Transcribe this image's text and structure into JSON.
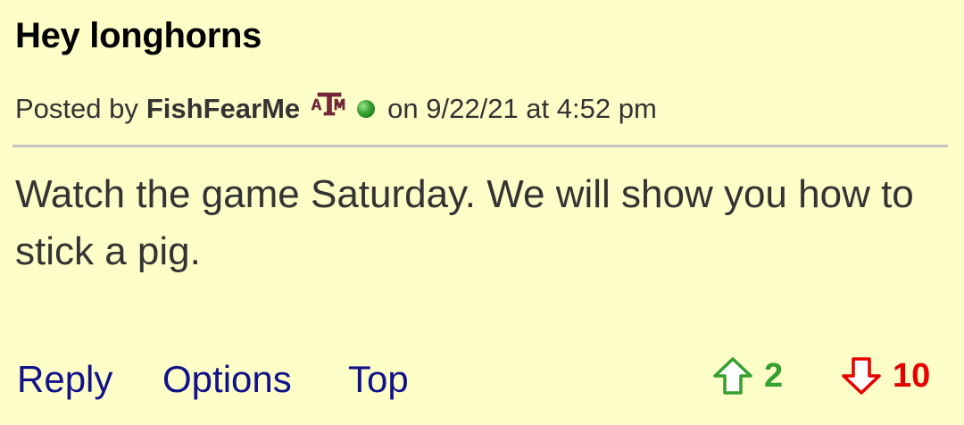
{
  "post": {
    "title": "Hey longhorns",
    "posted_by_prefix": "Posted by",
    "username": "FishFearMe",
    "team_logo_icon": "texas-am-logo-icon",
    "online_status_icon": "online-status-dot-icon",
    "date_text": "on 9/22/21 at 4:52 pm",
    "body": "Watch the game Saturday. We will show you how to stick a pig."
  },
  "actions": {
    "reply_label": "Reply",
    "options_label": "Options",
    "top_label": "Top"
  },
  "votes": {
    "up_icon": "thumbs-up-arrow-icon",
    "up_count": "2",
    "down_icon": "thumbs-down-arrow-icon",
    "down_count": "10"
  },
  "colors": {
    "background": "#fdfdc8",
    "link": "#11118a",
    "upvote": "#35a02f",
    "downvote": "#e60000",
    "logo_maroon": "#7a2a3a"
  }
}
